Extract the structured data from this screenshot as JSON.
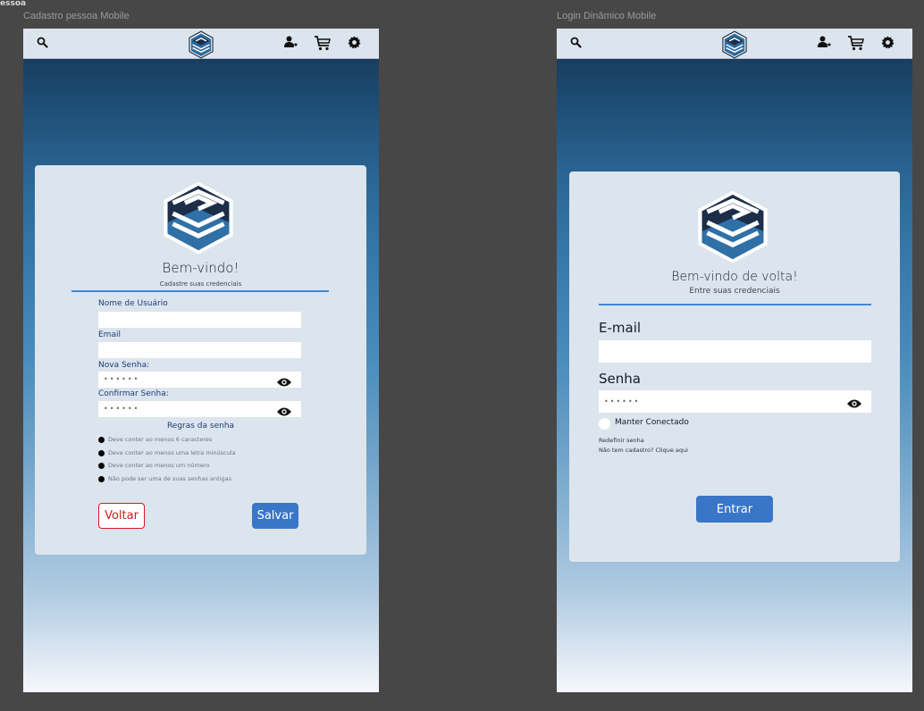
{
  "canvas": {
    "label": "essoa"
  },
  "frames": {
    "register": {
      "title": "Cadastro pessoa Mobile",
      "welcome": "Bem-vindo!",
      "subtitle": "Cadastre suas credenciais",
      "fields": {
        "username_label": "Nome de Usuário",
        "username_value": "",
        "email_label": "Email",
        "email_value": "",
        "password_label": "Nova Senha:",
        "password_value": "••••••",
        "confirm_label": "Confirmar Senha:",
        "confirm_value": "••••••"
      },
      "rules_title": "Regras da senha",
      "rules": [
        "Deve conter ao menos 6 caracteres",
        "Deve conter ao menos uma letra minúscula",
        "Deve conter ao menos um número",
        "Não pode ser uma de suas senhas antigas"
      ],
      "back_label": "Voltar",
      "save_label": "Salvar"
    },
    "login": {
      "title": "Login Dinâmico Mobile",
      "welcome": "Bem-vindo de volta!",
      "subtitle": "Entre suas credenciais",
      "fields": {
        "email_label": "E-mail",
        "email_value": "",
        "password_label": "Senha",
        "password_value": "••••••"
      },
      "keep_connected": "Manter Conectado",
      "reset_password": "Redefinir senha",
      "no_account": "Não tem cadastro? Clique aqui",
      "enter_label": "Entrar"
    }
  },
  "colors": {
    "accent": "#3a76c8",
    "danger": "#d31b1b",
    "card": "#dce5ed",
    "divider": "#3e86d6"
  },
  "icons": [
    "search-icon",
    "logo-icon",
    "user-login-icon",
    "cart-icon",
    "gear-icon",
    "eye-icon"
  ]
}
